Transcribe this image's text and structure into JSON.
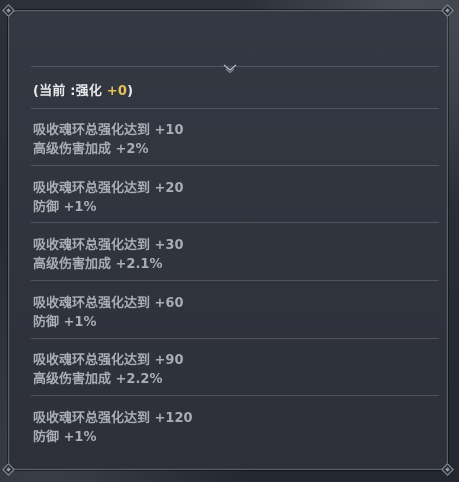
{
  "header": {
    "prefix": "(当前 :强化 ",
    "value": "+0",
    "suffix": ")"
  },
  "colors": {
    "value_highlight": "#e8c35a",
    "entry_text": "#a9adb5",
    "panel_bg": "#31353e"
  },
  "icons": {
    "collapse": "chevron-down-icon"
  },
  "entries": [
    {
      "requirement": "吸收魂环总强化达到 +10",
      "bonus": "高级伤害加成 +2%"
    },
    {
      "requirement": "吸收魂环总强化达到 +20",
      "bonus": "防御 +1%"
    },
    {
      "requirement": "吸收魂环总强化达到 +30",
      "bonus": "高级伤害加成 +2.1%"
    },
    {
      "requirement": "吸收魂环总强化达到 +60",
      "bonus": "防御 +1%"
    },
    {
      "requirement": "吸收魂环总强化达到 +90",
      "bonus": "高级伤害加成 +2.2%"
    },
    {
      "requirement": "吸收魂环总强化达到 +120",
      "bonus": "防御 +1%"
    }
  ]
}
